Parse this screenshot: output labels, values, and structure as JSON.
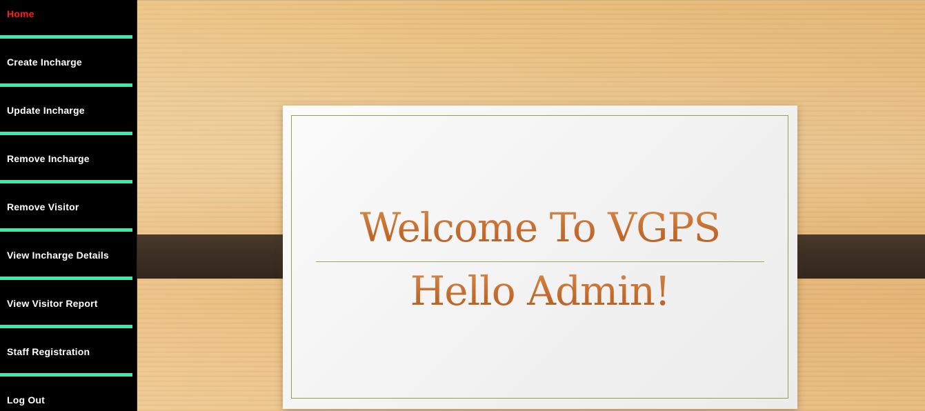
{
  "sidebar": {
    "items": [
      {
        "label": "Home",
        "active": true
      },
      {
        "label": "Create Incharge",
        "active": false
      },
      {
        "label": "Update Incharge",
        "active": false
      },
      {
        "label": "Remove Incharge",
        "active": false
      },
      {
        "label": "Remove Visitor",
        "active": false
      },
      {
        "label": "View Incharge Details",
        "active": false
      },
      {
        "label": "View Visitor Report",
        "active": false
      },
      {
        "label": "Staff Registration",
        "active": false
      },
      {
        "label": "Log Out",
        "active": false
      }
    ]
  },
  "slide": {
    "title": "Welcome To VGPS",
    "subtitle": "Hello Admin!"
  },
  "colors": {
    "sidebar_bg": "#000000",
    "separator": "#3ee8b0",
    "active_link": "#ff1a1a",
    "link": "#ffffff",
    "title_text": "#c7773a",
    "frame_border": "#8fa24a"
  }
}
